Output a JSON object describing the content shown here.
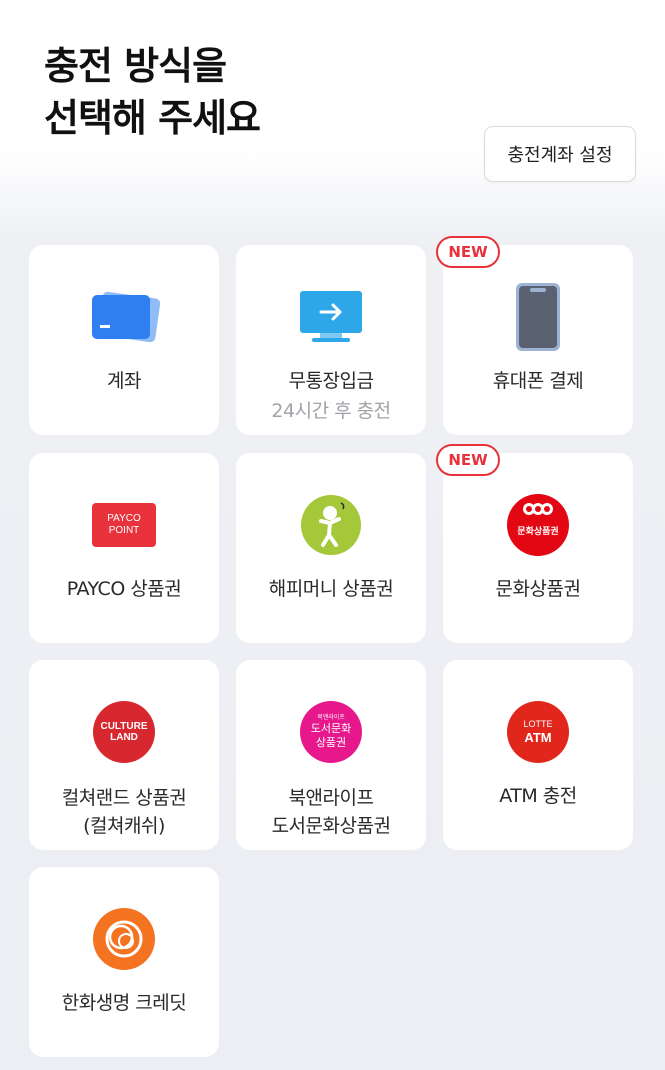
{
  "header": {
    "title_line1": "충전 방식을",
    "title_line2": "선택해 주세요",
    "settings_button": "충전계좌 설정"
  },
  "badge_new": "NEW",
  "methods": [
    {
      "label": "계좌",
      "icon": "card-icon"
    },
    {
      "label": "무통장입금",
      "sub": "24시간 후 충전",
      "icon": "monitor-arrow-icon"
    },
    {
      "label": "휴대폰 결제",
      "icon": "phone-icon",
      "new": true
    },
    {
      "label": "PAYCO 상품권",
      "icon": "payco-point-icon",
      "icon_text1": "PAYCO",
      "icon_text2": "POINT"
    },
    {
      "label": "해피머니 상품권",
      "icon": "happymoney-icon"
    },
    {
      "label": "문화상품권",
      "icon": "culture-voucher-icon",
      "icon_text": "문화상품권",
      "new": true
    },
    {
      "label": "컬쳐랜드 상품권",
      "label2": "(컬쳐캐쉬)",
      "icon": "cultureland-icon",
      "icon_text1": "CULTURE",
      "icon_text2": "LAND"
    },
    {
      "label": "북앤라이프",
      "label2": "도서문화상품권",
      "icon": "booknlife-icon",
      "icon_text0": "북앤라이프",
      "icon_text1": "도서문화",
      "icon_text2": "상품권"
    },
    {
      "label": "ATM 충전",
      "icon": "lotte-atm-icon",
      "icon_text1": "LOTTE",
      "icon_text2": "ATM"
    },
    {
      "label": "한화생명 크레딧",
      "icon": "hanwha-icon"
    }
  ],
  "colors": {
    "accent_red": "#e8323c",
    "card_blue": "#2f7ff0",
    "monitor_blue": "#2ea7e8",
    "phone_gray": "#5a6272",
    "happy_green": "#a4c839",
    "hanwha_orange": "#f37321",
    "booknlife_pink": "#e6188c"
  }
}
